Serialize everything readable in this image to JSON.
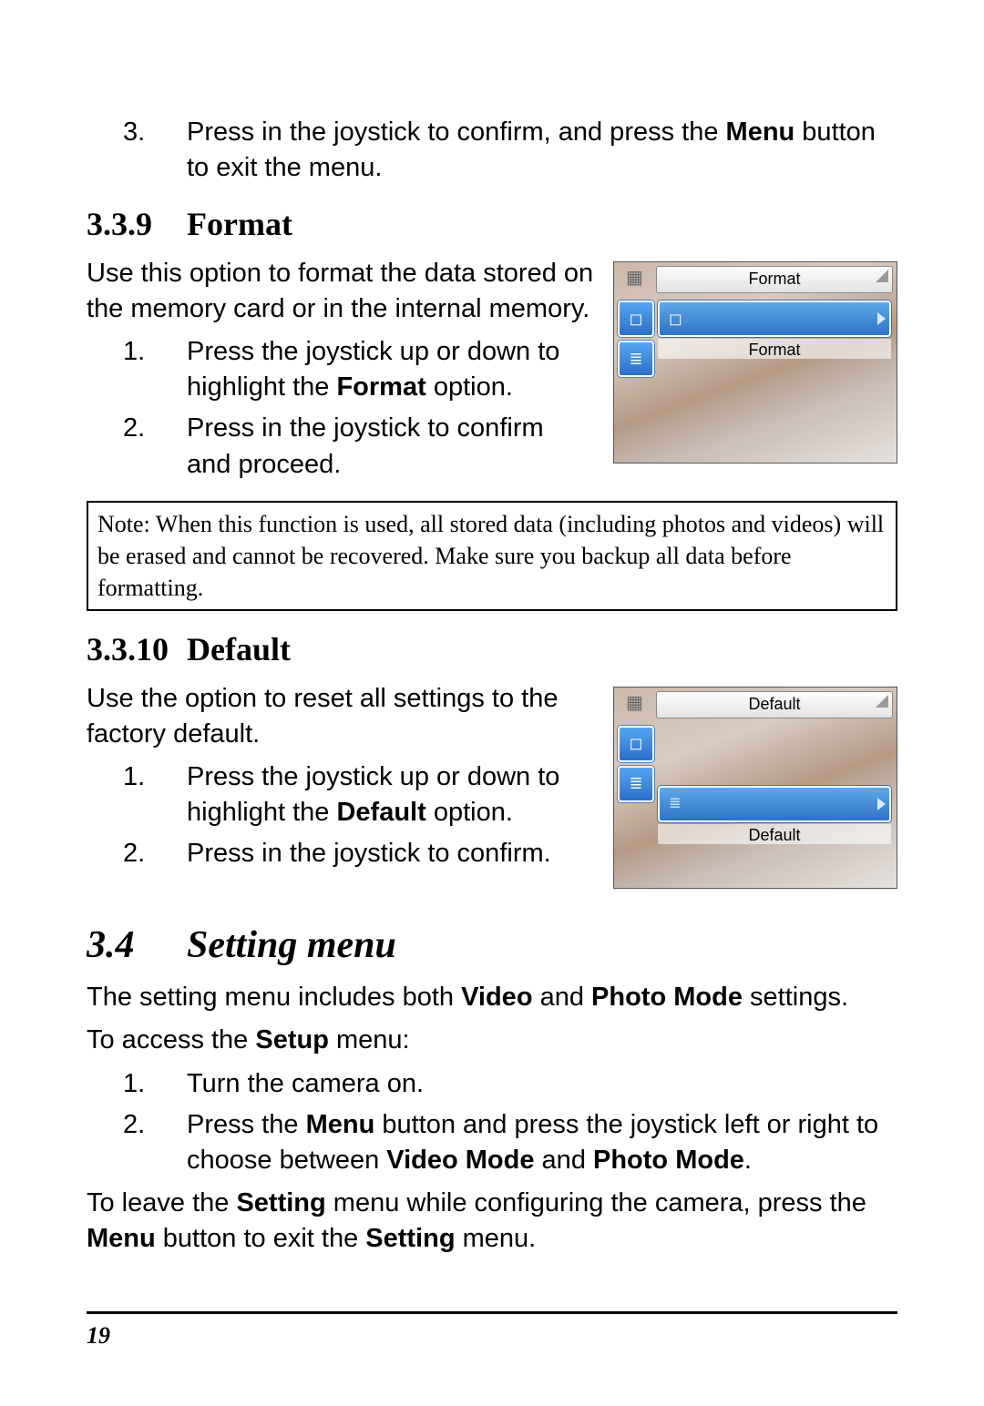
{
  "step3": {
    "num": "3.",
    "text_pre": "Press in the joystick to confirm, and press the ",
    "bold": "Menu",
    "text_post": " button to exit the menu."
  },
  "sec339": {
    "num": "3.3.9",
    "title": "Format",
    "intro": "Use this option to format the data stored on the memory card or in the internal memory.",
    "s1": {
      "num": "1.",
      "pre": "Press the joystick up or down to highlight the ",
      "bold": "Format",
      "post": " option."
    },
    "s2": {
      "num": "2.",
      "text": "Press in the joystick to confirm and proceed."
    },
    "cam": {
      "title": "Format",
      "row_label": "Format"
    }
  },
  "note": "Note: When this function is used, all stored data (including photos and videos) will be erased and cannot be recovered. Make sure you backup all data before formatting.",
  "sec3310": {
    "num": "3.3.10",
    "title": "Default",
    "intro": "Use the option to reset all settings to the factory default.",
    "s1": {
      "num": "1.",
      "pre": "Press the joystick up or down to highlight the ",
      "bold": "Default",
      "post": " option."
    },
    "s2": {
      "num": "2.",
      "text": "Press in the joystick to confirm."
    },
    "cam": {
      "title": "Default",
      "row_label": "Default"
    }
  },
  "sec34": {
    "num": "3.4",
    "title": "Setting menu",
    "intro_pre": "The setting menu includes both ",
    "intro_b1": "Video",
    "intro_mid": " and ",
    "intro_b2": "Photo Mode",
    "intro_post": " settings.",
    "access_pre": "To access the ",
    "access_b": "Setup",
    "access_post": " menu:",
    "s1": {
      "num": "1.",
      "text": "Turn the camera on."
    },
    "s2": {
      "num": "2.",
      "pre": "Press the ",
      "b1": "Menu",
      "mid1": " button and press the joystick left or right to choose between ",
      "b2": "Video Mode",
      "mid2": " and ",
      "b3": "Photo Mode",
      "post": "."
    },
    "leave_pre": "To leave the ",
    "leave_b1": "Setting",
    "leave_mid1": " menu while configuring the camera, press the ",
    "leave_b2": "Menu",
    "leave_mid2": " button to exit the ",
    "leave_b3": "Setting",
    "leave_post": " menu."
  },
  "pagenum": "19"
}
